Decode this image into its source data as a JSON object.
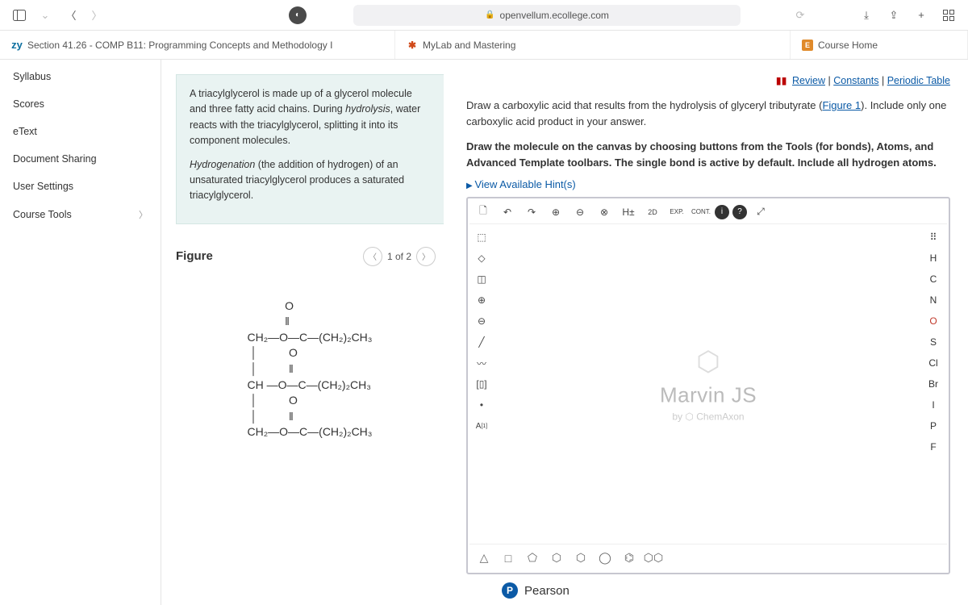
{
  "browser": {
    "url": "openvellum.ecollege.com"
  },
  "tabs": [
    {
      "icon": "zy",
      "label": "Section 41.26 - COMP B11: Programming Concepts and Methodology I"
    },
    {
      "icon": "mylab",
      "label": "MyLab and Mastering"
    },
    {
      "icon": "course",
      "label": "Course Home"
    }
  ],
  "sidebar": {
    "items": [
      {
        "label": "Syllabus"
      },
      {
        "label": "Scores"
      },
      {
        "label": "eText"
      },
      {
        "label": "Document Sharing"
      },
      {
        "label": "User Settings"
      },
      {
        "label": "Course Tools",
        "expandable": true
      }
    ]
  },
  "reading": {
    "intro_p1_a": "A triacylglycerol is made up of a glycerol molecule and three fatty acid chains. During ",
    "intro_p1_em": "hydrolysis",
    "intro_p1_b": ", water reacts with the triacylglycerol, splitting it into its component molecules.",
    "intro_p2_em": "Hydrogenation",
    "intro_p2_b": " (the addition of hydrogen) of an unsaturated triacylglycerol produces a saturated triacylglycerol.",
    "figure_label": "Figure",
    "figure_nav": "1 of 2"
  },
  "toplinks": {
    "review": "Review",
    "constants": "Constants",
    "periodic": "Periodic Table"
  },
  "problem": {
    "prompt_a": "Draw a carboxylic acid that results from the hydrolysis of glyceryl tributyrate (",
    "prompt_link": "Figure 1",
    "prompt_b": "). Include only one carboxylic acid product in your answer.",
    "instructions": "Draw the molecule on the canvas by choosing buttons from the Tools (for bonds), Atoms, and Advanced Template toolbars. The single bond is active by default. Include all hydrogen atoms.",
    "hints": "View Available Hint(s)"
  },
  "editor": {
    "top_tools": [
      "page",
      "undo",
      "redo",
      "zoom-in",
      "zoom-out",
      "zoom-fit",
      "h-toggle",
      "2d",
      "exp",
      "cont",
      "info",
      "help",
      "expand"
    ],
    "top_labels": {
      "h-toggle": "H±",
      "2d": "2D",
      "exp": "EXP.",
      "cont": "CONT.",
      "info": "i",
      "help": "?"
    },
    "left_tools": [
      "select",
      "marquee",
      "erase",
      "plus",
      "minus",
      "bond",
      "chain",
      "bracket",
      "dot",
      "charge"
    ],
    "left_labels": {
      "charge": "A",
      "bond": "╱",
      "chain": "〰"
    },
    "atoms": [
      "H",
      "C",
      "N",
      "O",
      "S",
      "Cl",
      "Br",
      "I",
      "P",
      "F"
    ],
    "shapes": [
      "triangle",
      "square",
      "pentagon",
      "hexagon",
      "hexagon2",
      "heptagon",
      "benzene",
      "fused"
    ],
    "logo_main": "Marvin JS",
    "logo_sub_by": "by",
    "logo_sub_brand": "ChemAxon"
  },
  "footer": {
    "pearson": "Pearson"
  }
}
